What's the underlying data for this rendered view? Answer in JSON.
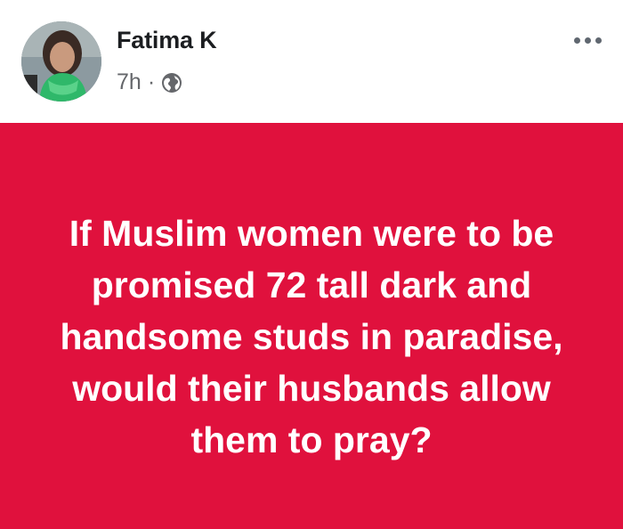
{
  "post": {
    "author_name": "Fatima K",
    "time_ago": "7h",
    "separator": "·",
    "privacy_icon": "globe-icon",
    "menu_icon": "more-horizontal-icon",
    "text": "If Muslim women were to be promised 72 tall dark and handsome studs in paradise, would their husbands allow them to pray?",
    "background_color": "#e0113d",
    "text_color": "#ffffff"
  }
}
